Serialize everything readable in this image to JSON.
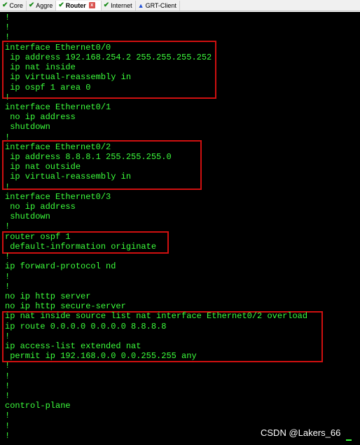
{
  "tabs": [
    {
      "label": "Core",
      "icon": "check-icon",
      "active": false
    },
    {
      "label": "Aggre",
      "icon": "check-icon",
      "active": false
    },
    {
      "label": "Router",
      "icon": "check-icon",
      "active": true
    },
    {
      "label": "Internet",
      "icon": "check-icon",
      "active": false
    },
    {
      "label": "GRT-Client",
      "icon": "warning-triangle-icon",
      "active": false
    }
  ],
  "close_tab_glyph": "x",
  "terminal": {
    "text_color": "#3cff3c",
    "background": "#000000",
    "lines": [
      "!",
      "!",
      "!",
      "interface Ethernet0/0",
      " ip address 192.168.254.2 255.255.255.252",
      " ip nat inside",
      " ip virtual-reassembly in",
      " ip ospf 1 area 0",
      "!",
      "interface Ethernet0/1",
      " no ip address",
      " shutdown",
      "!",
      "interface Ethernet0/2",
      " ip address 8.8.8.1 255.255.255.0",
      " ip nat outside",
      " ip virtual-reassembly in",
      "!",
      "interface Ethernet0/3",
      " no ip address",
      " shutdown",
      "!",
      "router ospf 1",
      " default-information originate",
      "!",
      "ip forward-protocol nd",
      "!",
      "!",
      "no ip http server",
      "no ip http secure-server",
      "ip nat inside source list nat interface Ethernet0/2 overload",
      "ip route 0.0.0.0 0.0.0.0 8.8.8.8",
      "!",
      "ip access-list extended nat",
      " permit ip 192.168.0.0 0.0.255.255 any",
      "!",
      "!",
      "!",
      "!",
      "control-plane",
      "!",
      "!",
      "!"
    ]
  },
  "highlight_color": "#d01010",
  "watermark": "CSDN @Lakers_66"
}
